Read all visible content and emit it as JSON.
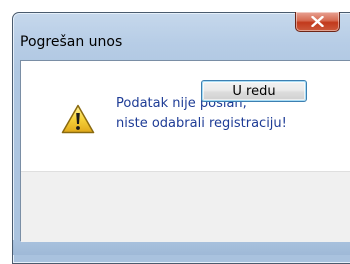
{
  "dialog": {
    "title": "Pogrešan unos",
    "close_label": "X",
    "message_line1": "Podatak nije poslan,",
    "message_line2": "niste odabrali registraciju!",
    "ok_label": "U redu",
    "icon": "warning-icon"
  },
  "colors": {
    "message_text": "#1e3c96",
    "close_button": "#c2391c",
    "frame": "#b7cde6"
  }
}
